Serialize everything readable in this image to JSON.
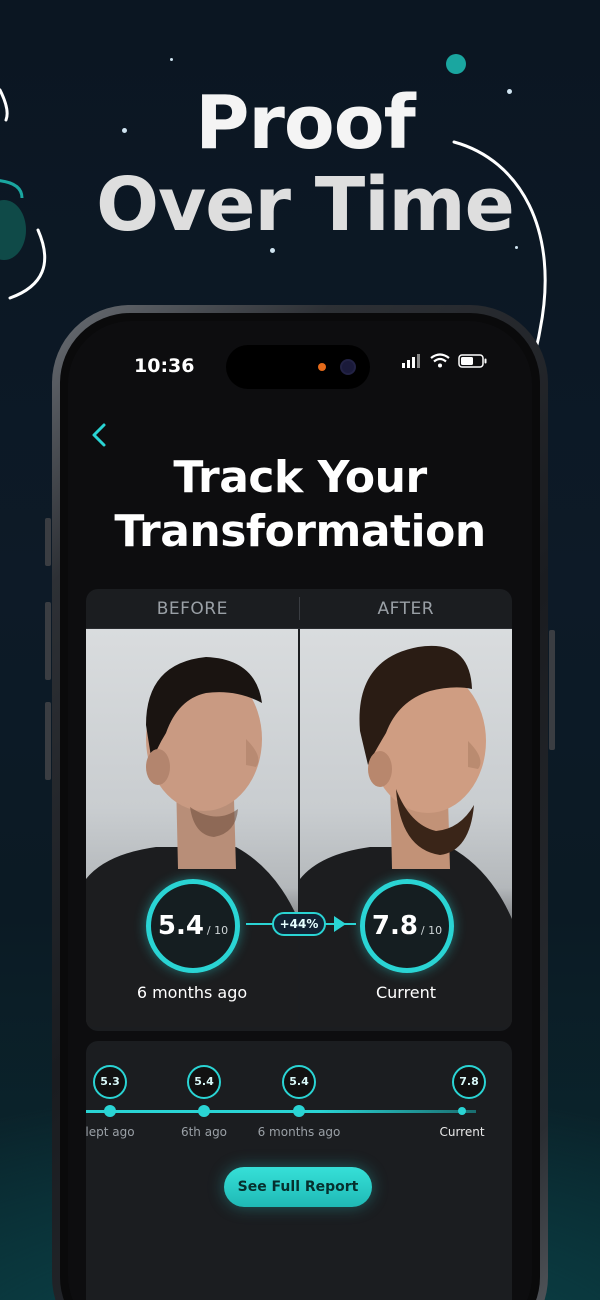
{
  "promo": {
    "headline_line1": "Proof",
    "headline_line2": "Over Time"
  },
  "status_bar": {
    "time": "10:36"
  },
  "screen": {
    "title_line1": "Track Your",
    "title_line2": "Transformation",
    "back_icon": "chevron-left-icon"
  },
  "compare": {
    "before_label": "BEFORE",
    "after_label": "AFTER",
    "before": {
      "score": "5.4",
      "denominator": "/ 10",
      "caption": "6 months ago"
    },
    "after": {
      "score": "7.8",
      "denominator": "/ 10",
      "caption": "Current"
    },
    "delta": "+44%"
  },
  "timeline": {
    "points": [
      {
        "score": "5.3",
        "label": "lept ago"
      },
      {
        "score": "5.4",
        "label": "6th ago"
      },
      {
        "score": "5.4",
        "label": "6 months ago"
      },
      {
        "score": "7.8",
        "label": "Current"
      }
    ],
    "button_label": "See Full Report"
  },
  "colors": {
    "accent": "#2ad4d4",
    "background": "#0b1622"
  }
}
